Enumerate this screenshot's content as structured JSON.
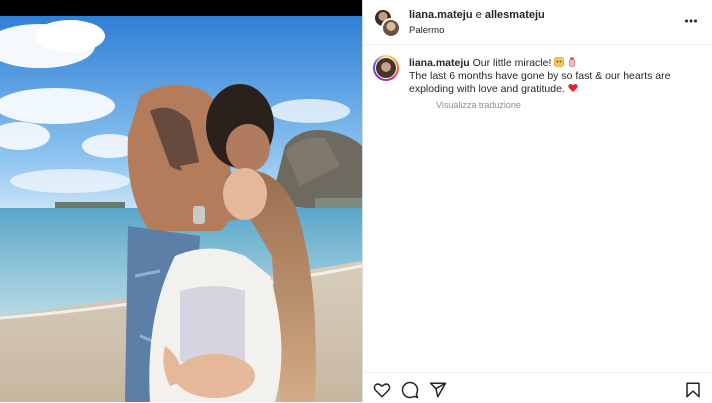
{
  "post": {
    "author_primary": "liana.mateju",
    "conjunction": "e",
    "author_secondary": "allesmateju",
    "location": "Palermo"
  },
  "caption": {
    "username": "liana.mateju",
    "line1": "Our little miracle!",
    "body": "The last 6 months have gone by so fast & our hearts are exploding with love and gratitude.",
    "translate_link": "Visualizza traduzione"
  },
  "icons": {
    "more": "more-options-icon",
    "like": "heart-icon",
    "comment": "comment-icon",
    "share": "share-icon",
    "save": "bookmark-icon"
  },
  "colors": {
    "text": "#262626",
    "muted": "#8e8e8e",
    "heart": "#ed1f2c"
  }
}
